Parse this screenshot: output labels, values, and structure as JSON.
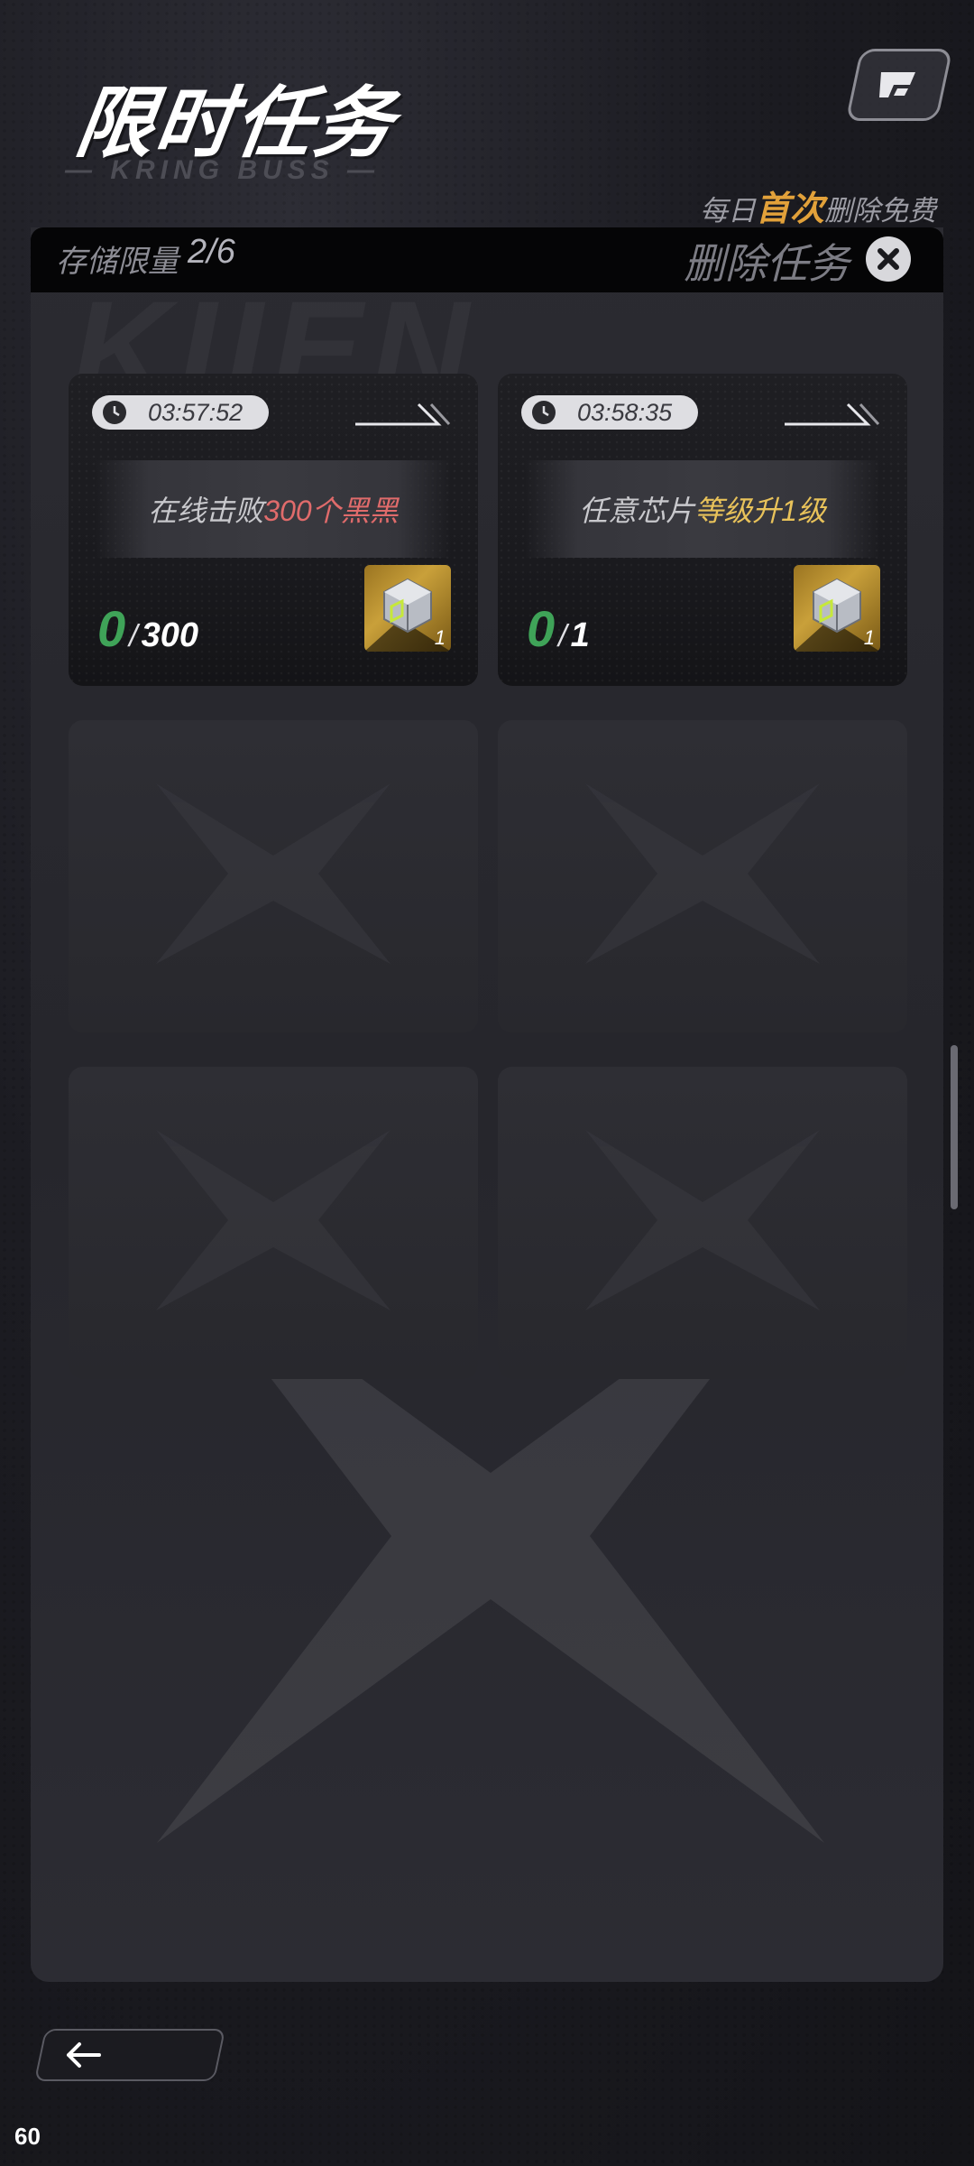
{
  "header": {
    "title": "限时任务",
    "subtitle_deco": "— KRING BUSS —",
    "free_note_prefix": "每日",
    "free_note_highlight": "首次",
    "free_note_suffix": "删除免费"
  },
  "storage": {
    "label": "存储限量",
    "value": "2/6"
  },
  "delete": {
    "label": "删除任务"
  },
  "background_text": "KIIEN",
  "tasks": [
    {
      "time": "03:57:52",
      "desc_prefix": "在线击败",
      "desc_highlight": "300个黑黑",
      "desc_suffix": "",
      "current": "0",
      "goal": "300",
      "reward_count": "1",
      "highlight_color": "#e06b6b"
    },
    {
      "time": "03:58:35",
      "desc_prefix": "任意芯片",
      "desc_highlight": "等级升1级",
      "desc_suffix": "",
      "current": "0",
      "goal": "1",
      "reward_count": "1",
      "highlight_color": "#e8c25a"
    }
  ],
  "empty_slots": 4,
  "fps": "60",
  "colors": {
    "accent_gold": "#e2a13a",
    "progress_green": "#3fa358",
    "panel": "#2b2b31"
  },
  "icons": {
    "top_right": "share-icon",
    "delete": "close-icon",
    "timer": "history-clock-icon",
    "back": "arrow-left-icon",
    "reward": "chip-crate-icon"
  }
}
